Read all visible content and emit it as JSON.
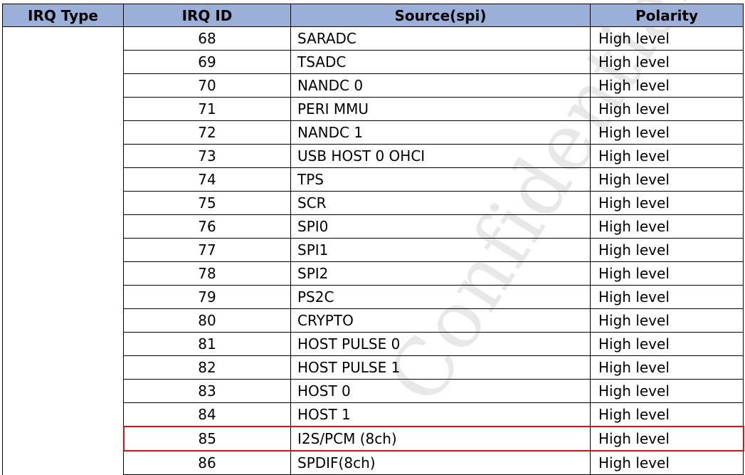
{
  "table": {
    "headers": {
      "irq_type": "IRQ Type",
      "irq_id": "IRQ ID",
      "source": "Source(spi)",
      "polarity": "Polarity"
    },
    "irq_type_value": "",
    "rows": [
      {
        "id": "68",
        "source": "SARADC",
        "polarity": "High level"
      },
      {
        "id": "69",
        "source": "TSADC",
        "polarity": "High level"
      },
      {
        "id": "70",
        "source": "NANDC 0",
        "polarity": "High level"
      },
      {
        "id": "71",
        "source": "PERI MMU",
        "polarity": "High level"
      },
      {
        "id": "72",
        "source": "NANDC 1",
        "polarity": "High level"
      },
      {
        "id": "73",
        "source": "USB HOST 0 OHCI",
        "polarity": "High level"
      },
      {
        "id": "74",
        "source": "TPS",
        "polarity": "High level"
      },
      {
        "id": "75",
        "source": "SCR",
        "polarity": "High level"
      },
      {
        "id": "76",
        "source": "SPI0",
        "polarity": "High level"
      },
      {
        "id": "77",
        "source": "SPI1",
        "polarity": "High level"
      },
      {
        "id": "78",
        "source": "SPI2",
        "polarity": "High level"
      },
      {
        "id": "79",
        "source": "PS2C",
        "polarity": "High level"
      },
      {
        "id": "80",
        "source": "CRYPTO",
        "polarity": "High level"
      },
      {
        "id": "81",
        "source": "HOST PULSE 0",
        "polarity": "High level"
      },
      {
        "id": "82",
        "source": "HOST PULSE 1",
        "polarity": "High level"
      },
      {
        "id": "83",
        "source": "HOST 0",
        "polarity": "High level"
      },
      {
        "id": "84",
        "source": "HOST 1",
        "polarity": "High level"
      },
      {
        "id": "85",
        "source": "I2S/PCM (8ch)",
        "polarity": "High level",
        "highlighted": true
      },
      {
        "id": "86",
        "source": "SPDIF(8ch)",
        "polarity": "High level"
      }
    ]
  },
  "watermark": {
    "text": "Confidential"
  },
  "colors": {
    "header_bg": "#9ab0d9",
    "highlight_border": "#e01010",
    "watermark": "#969696"
  }
}
